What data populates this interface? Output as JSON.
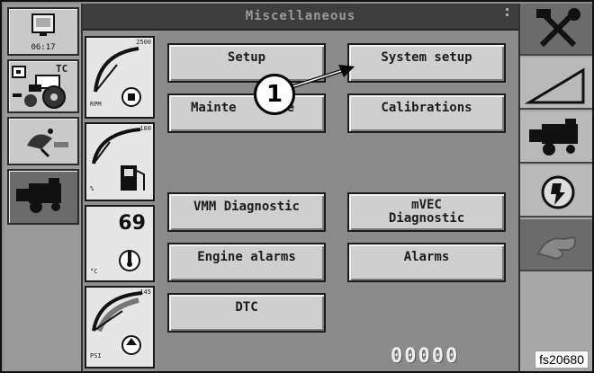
{
  "header": {
    "title": "Miscellaneous"
  },
  "left_panel": {
    "clock": "06:17",
    "tc_label": "TC"
  },
  "gauges": {
    "rpm": {
      "unit": "RPM",
      "max_label": "2500"
    },
    "fuel": {
      "unit": "%",
      "max_label": "100"
    },
    "coolant": {
      "value": "69",
      "unit": "°C"
    },
    "oil": {
      "unit": "PSI",
      "max_label": "145"
    }
  },
  "menu": {
    "setup": "Setup",
    "system_setup": "System setup",
    "maintenance": "Mainte",
    "maintenance_tail": "e",
    "calibrations": "Calibrations",
    "vmm_diagnostic": "VMM Diagnostic",
    "mvec_diagnostic_1": "mVEC",
    "mvec_diagnostic_2": "Diagnostic",
    "engine_alarms": "Engine alarms",
    "alarms": "Alarms",
    "dtc": "DTC"
  },
  "counter": "00000",
  "callout": {
    "number": "1"
  },
  "figure_label": "fs20680"
}
